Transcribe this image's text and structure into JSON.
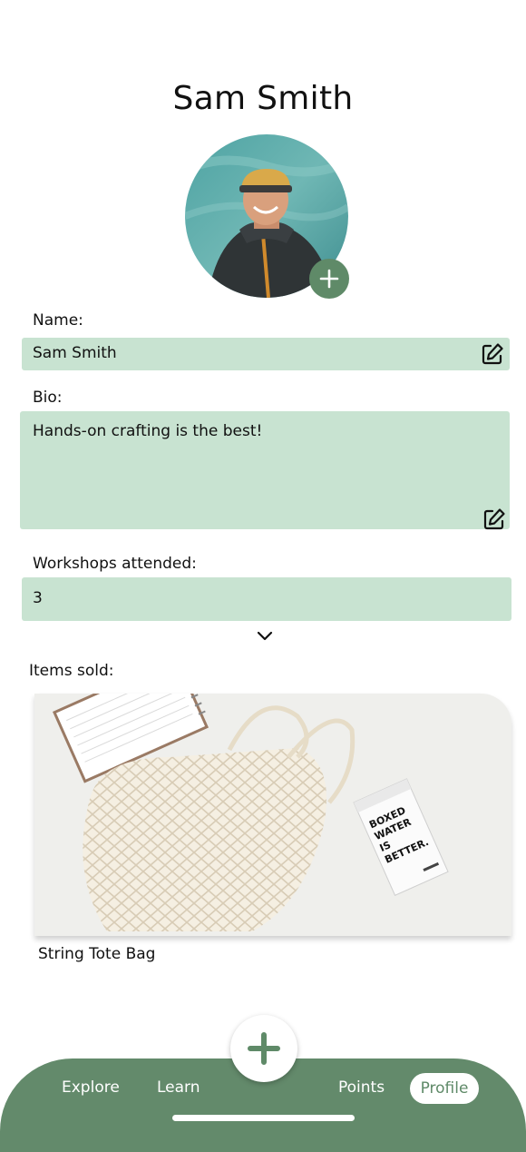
{
  "profile": {
    "title": "Sam Smith",
    "avatar_alt": "profile photo"
  },
  "form": {
    "name_label": "Name:",
    "name_value": "Sam Smith",
    "bio_label": "Bio:",
    "bio_value": "Hands-on crafting is the best!",
    "workshops_label": "Workshops attended:",
    "workshops_value": "3"
  },
  "items": {
    "label": "Items sold:",
    "list": [
      {
        "caption": "String Tote Bag",
        "carton_text": "BOXED WATER IS BETTER."
      }
    ]
  },
  "nav": {
    "items": [
      "Explore",
      "Learn",
      "Points",
      "Profile"
    ],
    "active": "Profile"
  },
  "icons": {
    "avatar_add": "plus-icon",
    "edit": "edit-icon",
    "expand": "chevron-down-icon",
    "fab": "plus-icon"
  },
  "colors": {
    "accent": "#5f8a68",
    "field_bg": "#c8e3d1",
    "nav_bg": "#638a6b"
  }
}
